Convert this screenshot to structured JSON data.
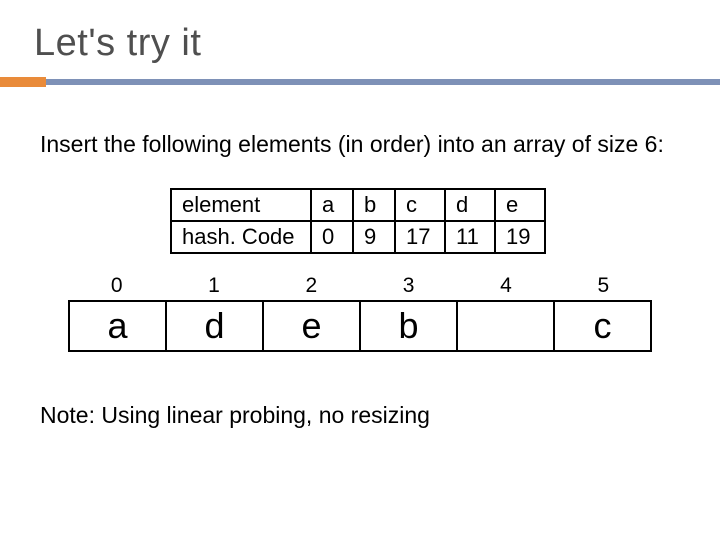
{
  "title": "Let's try it",
  "intro": "Insert the following elements (in order) into an array of size 6:",
  "hash": {
    "row1_label": "element",
    "row2_label": "hash. Code",
    "cols": {
      "c0": "a",
      "c1": "b",
      "c2": "c",
      "c3": "d",
      "c4": "e"
    },
    "vals": {
      "v0": "0",
      "v1": "9",
      "v2": "17",
      "v3": "11",
      "v4": "19"
    }
  },
  "indices": {
    "i0": "0",
    "i1": "1",
    "i2": "2",
    "i3": "3",
    "i4": "4",
    "i5": "5"
  },
  "slots": {
    "s0": "a",
    "s1": "d",
    "s2": "e",
    "s3": "b",
    "s4": "",
    "s5": "c"
  },
  "note": "Note: Using linear probing, no resizing",
  "chart_data": {
    "type": "table",
    "title": "Hash codes and resulting array after linear probing (size 6, no resizing)",
    "elements": [
      {
        "element": "a",
        "hashCode": 0
      },
      {
        "element": "b",
        "hashCode": 9
      },
      {
        "element": "c",
        "hashCode": 17
      },
      {
        "element": "d",
        "hashCode": 11
      },
      {
        "element": "e",
        "hashCode": 19
      }
    ],
    "array_size": 6,
    "array": [
      "a",
      "d",
      "e",
      "b",
      "",
      "c"
    ]
  }
}
